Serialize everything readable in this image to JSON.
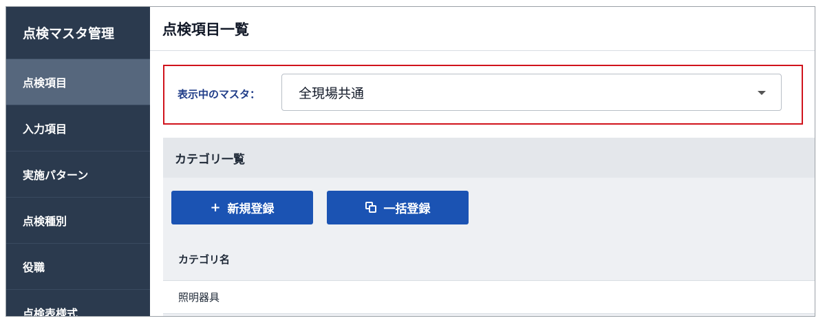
{
  "sidebar": {
    "title": "点検マスタ管理",
    "items": [
      {
        "label": "点検項目"
      },
      {
        "label": "入力項目"
      },
      {
        "label": "実施パターン"
      },
      {
        "label": "点検種別"
      },
      {
        "label": "役職"
      },
      {
        "label": "点検表様式"
      }
    ],
    "active_index": 0
  },
  "main": {
    "page_title": "点検項目一覧",
    "master_label": "表示中のマスタ：",
    "master_value": "全現場共通",
    "category_panel": {
      "title": "カテゴリ一覧",
      "new_button": {
        "icon": "plus-icon",
        "glyph": "+",
        "label": "新規登録"
      },
      "bulk_button": {
        "icon": "copy-icon",
        "label": "一括登録"
      },
      "column_header": "カテゴリ名",
      "rows": [
        "照明器具"
      ]
    }
  },
  "colors": {
    "sidebar_bg": "#2b3a4e",
    "sidebar_active": "#56677d",
    "primary": "#1b53b3",
    "highlight": "#d0121b",
    "label_blue": "#1f3c88"
  }
}
